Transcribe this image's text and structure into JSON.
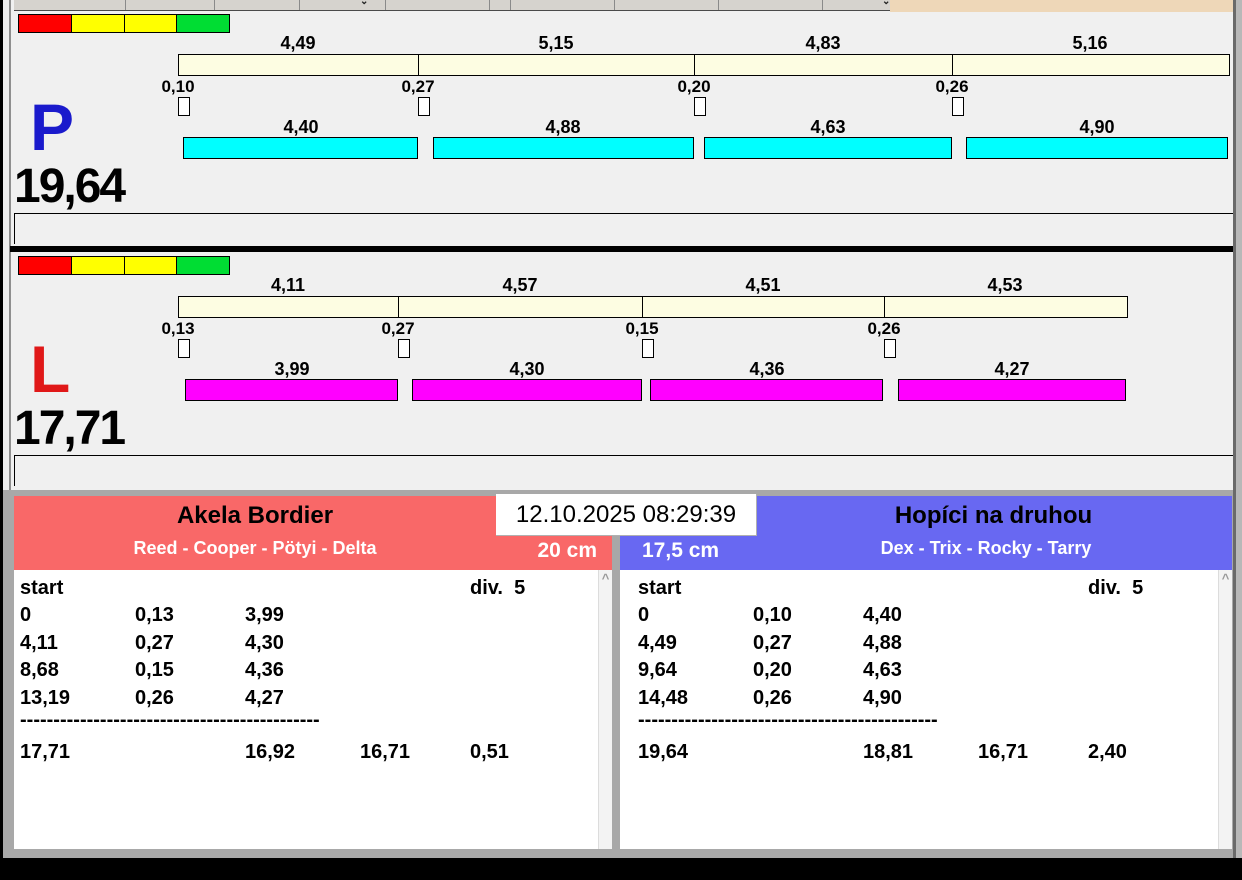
{
  "window": {
    "datetime": "12.10.2025 08:29:39"
  },
  "ui": {
    "toolbar_chevron": "⌄",
    "scroll_up_glyph": "^"
  },
  "colors": {
    "split_bar": "#fdfde2",
    "lane_p_bar": "#00ffff",
    "lane_l_bar": "#ff00ff",
    "lane_p_letter": "#1a1acc",
    "lane_l_letter": "#e01818",
    "team_left_header": "#f96868",
    "team_right_header": "#6868f2",
    "traffic_lights": [
      "#ff0000",
      "#ffff00",
      "#ffff00",
      "#00dd33"
    ]
  },
  "lanes": [
    {
      "letter": "P",
      "total": "19,64",
      "letter_color": "#1a1acc",
      "bar_color": "#00ffff",
      "segments": [
        {
          "split": "4,49",
          "cross": "0,10",
          "clean": "4,40"
        },
        {
          "split": "5,15",
          "cross": "0,27",
          "clean": "4,88"
        },
        {
          "split": "4,83",
          "cross": "0,20",
          "clean": "4,63"
        },
        {
          "split": "5,16",
          "cross": "0,26",
          "clean": "4,90"
        }
      ]
    },
    {
      "letter": "L",
      "total": "17,71",
      "letter_color": "#e01818",
      "bar_color": "#ff00ff",
      "segments": [
        {
          "split": "4,11",
          "cross": "0,13",
          "clean": "3,99"
        },
        {
          "split": "4,57",
          "cross": "0,27",
          "clean": "4,30"
        },
        {
          "split": "4,51",
          "cross": "0,15",
          "clean": "4,36"
        },
        {
          "split": "4,53",
          "cross": "0,26",
          "clean": "4,27"
        }
      ]
    }
  ],
  "teams": [
    {
      "name": "Akela Bordier",
      "dogs": "Reed - Cooper - Pötyi - Delta",
      "jump_height": "20 cm",
      "header_color": "#f96868",
      "table": {
        "header_left": "start",
        "header_right": "div.  5",
        "rows": [
          [
            "0",
            "0,13",
            "3,99"
          ],
          [
            "4,11",
            "0,27",
            "4,30"
          ],
          [
            "8,68",
            "0,15",
            "4,36"
          ],
          [
            "13,19",
            "0,26",
            "4,27"
          ]
        ],
        "separator": "---------------------------------------------",
        "totals": [
          "17,71",
          "16,92",
          "16,71",
          "0,51"
        ]
      }
    },
    {
      "name": "Hopíci na druhou",
      "dogs": "Dex - Trix - Rocky - Tarry",
      "jump_height": "17,5 cm",
      "header_color": "#6868f2",
      "table": {
        "header_left": "start",
        "header_right": "div.  5",
        "rows": [
          [
            "0",
            "0,10",
            "4,40"
          ],
          [
            "4,49",
            "0,27",
            "4,88"
          ],
          [
            "9,64",
            "0,20",
            "4,63"
          ],
          [
            "14,48",
            "0,26",
            "4,90"
          ]
        ],
        "separator": "---------------------------------------------",
        "totals": [
          "19,64",
          "18,81",
          "16,71",
          "2,40"
        ]
      }
    }
  ]
}
